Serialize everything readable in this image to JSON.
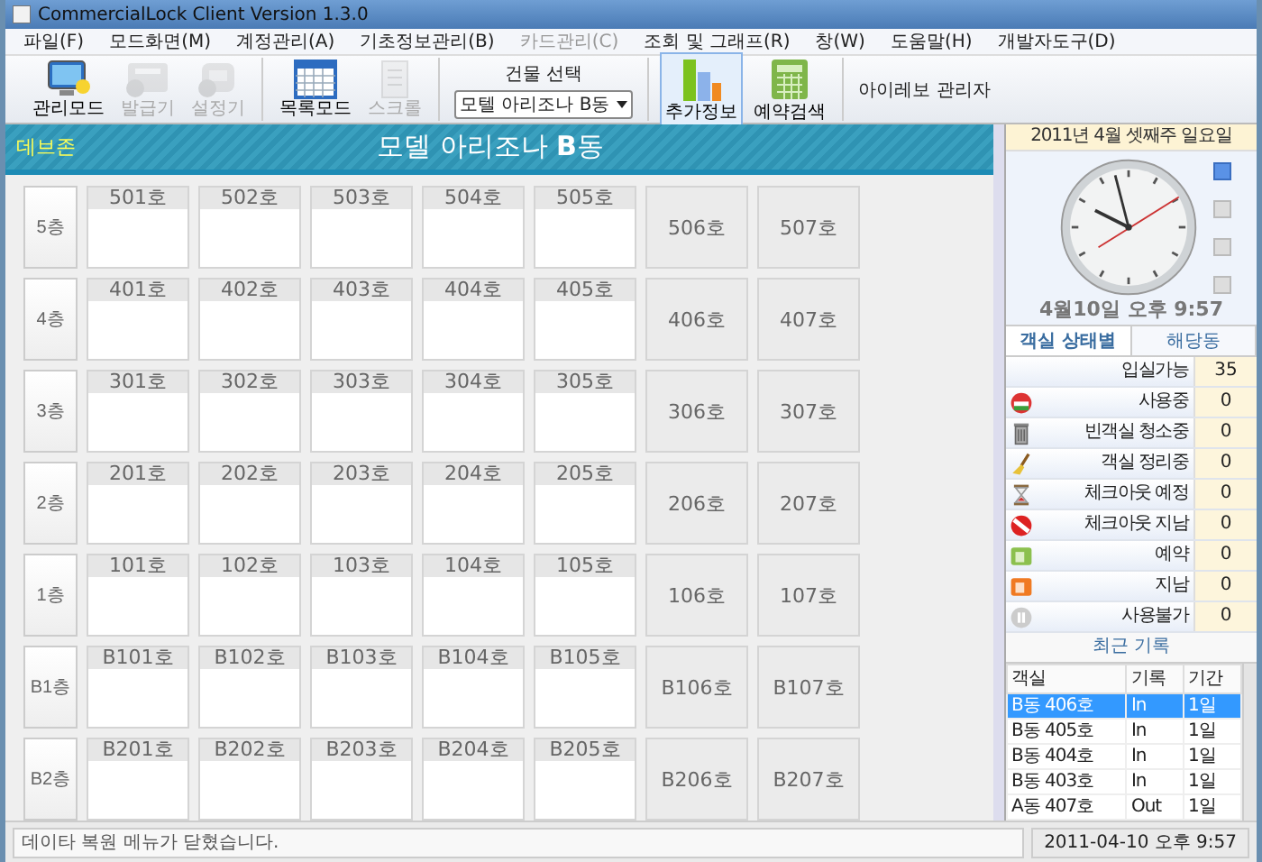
{
  "window": {
    "title": "CommercialLock Client Version 1.3.0"
  },
  "menu": [
    {
      "label": "파일(F)",
      "disabled": false
    },
    {
      "label": "모드화면(M)",
      "disabled": false
    },
    {
      "label": "계정관리(A)",
      "disabled": false
    },
    {
      "label": "기초정보관리(B)",
      "disabled": false
    },
    {
      "label": "카드관리(C)",
      "disabled": true
    },
    {
      "label": "조회 및 그래프(R)",
      "disabled": false
    },
    {
      "label": "창(W)",
      "disabled": false
    },
    {
      "label": "도움말(H)",
      "disabled": false
    },
    {
      "label": "개발자도구(D)",
      "disabled": false
    }
  ],
  "toolbar": {
    "groups": [
      [
        {
          "label": "관리모드",
          "kind": "monitor",
          "disabled": false,
          "selected": false
        },
        {
          "label": "발급기",
          "kind": "reader",
          "disabled": true,
          "selected": false
        },
        {
          "label": "설정기",
          "kind": "device",
          "disabled": true,
          "selected": false
        }
      ],
      [
        {
          "label": "목록모드",
          "kind": "grid",
          "disabled": false,
          "selected": false
        },
        {
          "label": "스크롤",
          "kind": "document",
          "disabled": true,
          "selected": false
        }
      ]
    ],
    "building_select": {
      "label": "건물 선택",
      "value": "모텔 아리조나 B동"
    },
    "extra": [
      {
        "label": "추가정보",
        "kind": "chart",
        "disabled": false,
        "selected": true
      },
      {
        "label": "예약검색",
        "kind": "calculator",
        "disabled": false,
        "selected": false
      }
    ],
    "user": "아이레보 관리자"
  },
  "header": {
    "zone": "데브존",
    "title": "모델 아리조나 **B**동"
  },
  "floors": [
    {
      "label": "5층",
      "rooms": [
        {
          "label": "501호",
          "kind": "panel"
        },
        {
          "label": "502호",
          "kind": "panel"
        },
        {
          "label": "503호",
          "kind": "panel"
        },
        {
          "label": "504호",
          "kind": "panel"
        },
        {
          "label": "505호",
          "kind": "panel"
        },
        {
          "label": "506호",
          "kind": "plain"
        },
        {
          "label": "507호",
          "kind": "plain"
        }
      ]
    },
    {
      "label": "4층",
      "rooms": [
        {
          "label": "401호",
          "kind": "panel"
        },
        {
          "label": "402호",
          "kind": "panel"
        },
        {
          "label": "403호",
          "kind": "panel"
        },
        {
          "label": "404호",
          "kind": "panel"
        },
        {
          "label": "405호",
          "kind": "panel"
        },
        {
          "label": "406호",
          "kind": "plain"
        },
        {
          "label": "407호",
          "kind": "plain"
        }
      ]
    },
    {
      "label": "3층",
      "rooms": [
        {
          "label": "301호",
          "kind": "panel"
        },
        {
          "label": "302호",
          "kind": "panel"
        },
        {
          "label": "303호",
          "kind": "panel"
        },
        {
          "label": "304호",
          "kind": "panel"
        },
        {
          "label": "305호",
          "kind": "panel"
        },
        {
          "label": "306호",
          "kind": "plain"
        },
        {
          "label": "307호",
          "kind": "plain"
        }
      ]
    },
    {
      "label": "2층",
      "rooms": [
        {
          "label": "201호",
          "kind": "panel"
        },
        {
          "label": "202호",
          "kind": "panel"
        },
        {
          "label": "203호",
          "kind": "panel"
        },
        {
          "label": "204호",
          "kind": "panel"
        },
        {
          "label": "205호",
          "kind": "panel"
        },
        {
          "label": "206호",
          "kind": "plain"
        },
        {
          "label": "207호",
          "kind": "plain"
        }
      ]
    },
    {
      "label": "1층",
      "rooms": [
        {
          "label": "101호",
          "kind": "panel"
        },
        {
          "label": "102호",
          "kind": "panel"
        },
        {
          "label": "103호",
          "kind": "panel"
        },
        {
          "label": "104호",
          "kind": "panel"
        },
        {
          "label": "105호",
          "kind": "panel"
        },
        {
          "label": "106호",
          "kind": "plain"
        },
        {
          "label": "107호",
          "kind": "plain"
        }
      ]
    },
    {
      "label": "B1층",
      "rooms": [
        {
          "label": "B101호",
          "kind": "panel"
        },
        {
          "label": "B102호",
          "kind": "panel"
        },
        {
          "label": "B103호",
          "kind": "panel"
        },
        {
          "label": "B104호",
          "kind": "panel"
        },
        {
          "label": "B105호",
          "kind": "panel"
        },
        {
          "label": "B106호",
          "kind": "plain"
        },
        {
          "label": "B107호",
          "kind": "plain"
        }
      ]
    },
    {
      "label": "B2층",
      "rooms": [
        {
          "label": "B201호",
          "kind": "panel"
        },
        {
          "label": "B202호",
          "kind": "panel"
        },
        {
          "label": "B203호",
          "kind": "panel"
        },
        {
          "label": "B204호",
          "kind": "panel"
        },
        {
          "label": "B205호",
          "kind": "panel"
        },
        {
          "label": "B206호",
          "kind": "plain"
        },
        {
          "label": "B207호",
          "kind": "plain"
        }
      ]
    }
  ],
  "sidebar": {
    "date": "2011년 4월 셋째주 일요일",
    "clock_pages": [
      {
        "selected": true
      },
      {
        "selected": false
      },
      {
        "selected": false
      },
      {
        "selected": false
      }
    ],
    "clock_text": "4월10일 오후 9:57",
    "tabs": [
      {
        "label": "객실 상태별",
        "selected": true
      },
      {
        "label": "해당동",
        "selected": false
      }
    ],
    "statuses": [
      {
        "label": "입실가능",
        "count": "35",
        "kind": "none"
      },
      {
        "label": "사용중",
        "count": "0",
        "kind": "car"
      },
      {
        "label": "빈객실 청소중",
        "count": "0",
        "kind": "trash"
      },
      {
        "label": "객실 정리중",
        "count": "0",
        "kind": "broom"
      },
      {
        "label": "체크아웃 예정",
        "count": "0",
        "kind": "hourglass"
      },
      {
        "label": "체크아웃 지남",
        "count": "0",
        "kind": "noentry"
      },
      {
        "label": "예약",
        "count": "0",
        "kind": "green"
      },
      {
        "label": "지남",
        "count": "0",
        "kind": "orange"
      },
      {
        "label": "사용불가",
        "count": "0",
        "kind": "pause"
      }
    ],
    "recent_title": "최근 기록",
    "recent": {
      "columns": [
        "객실",
        "기록",
        "기간"
      ],
      "rows": [
        {
          "cells": [
            "B동 406호",
            "In",
            "1일"
          ],
          "selected": true
        },
        {
          "cells": [
            "B동 405호",
            "In",
            "1일"
          ],
          "selected": false
        },
        {
          "cells": [
            "B동 404호",
            "In",
            "1일"
          ],
          "selected": false
        },
        {
          "cells": [
            "B동 403호",
            "In",
            "1일"
          ],
          "selected": false
        },
        {
          "cells": [
            "A동 407호",
            "Out",
            "1일"
          ],
          "selected": false
        }
      ]
    }
  },
  "status_bar": {
    "message": "데이타 복원 메뉴가 닫혔습니다.",
    "datetime": "2011-04-10 오후 9:57"
  }
}
